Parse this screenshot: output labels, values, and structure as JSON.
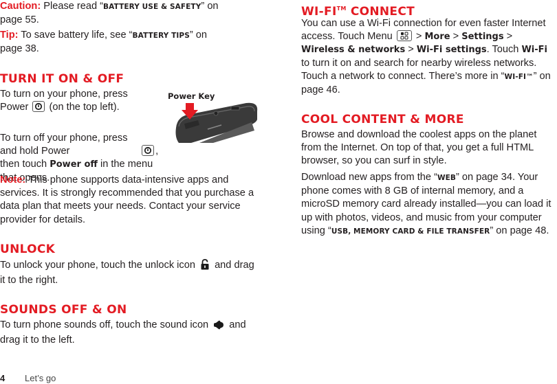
{
  "left": {
    "caution": {
      "label": "Caution:",
      "text_before": " Please read “",
      "ref": "Battery Use & Safety",
      "text_after": "” on page 55."
    },
    "tip": {
      "label": "Tip:",
      "text_before": " To save battery life, see “",
      "ref": "Battery Tips",
      "text_after": "” on page 38."
    },
    "turn_on_off": {
      "heading": "Turn it on & off",
      "p1_a": "To turn on your phone, press Power",
      "p1_b": " (on the top left).",
      "p2_a": "To turn off your phone, press and hold Power",
      "p2_b": ", then touch ",
      "p2_bold": "Power off",
      "p2_c": " in the menu that opens.",
      "figure_label": "Power Key",
      "power_icon": "power-key-icon"
    },
    "note": {
      "label": "Note:",
      "text": " This phone supports data-intensive apps and services. It is strongly recommended that you purchase a data plan that meets your needs. Contact your service provider for details."
    },
    "unlock": {
      "heading": "Unlock",
      "text_a": "To unlock your phone, touch the unlock icon",
      "text_b": " and drag it to the right.",
      "icon": "lock-icon"
    },
    "sounds": {
      "heading": "Sounds off & on",
      "text_a": "To turn phone sounds off, touch the sound icon",
      "text_b": " and drag it to the left.",
      "icon": "speaker-icon"
    }
  },
  "right": {
    "wifi": {
      "heading": "Wi-Fi",
      "heading_tm": "TM",
      "heading_rest": " Connect",
      "t1": "You can use a Wi-Fi connection for even faster Internet access. Touch Menu",
      "t2": " > ",
      "more": "More",
      "t3": " > ",
      "settings": "Settings",
      "t4": " > ",
      "wireless": "Wireless & networks",
      "t5": " > ",
      "wifi_settings": "Wi-Fi settings",
      "t6": ". Touch ",
      "wifi_bold": "Wi-Fi",
      "t7": " to turn it on and search for nearby wireless networks. Touch a network to connect. There’s more in “",
      "ref": "Wi-Fi™",
      "t8": "” on page 46.",
      "menu_icon": "menu-key-icon"
    },
    "cool": {
      "heading": "Cool content & more",
      "p1": "Browse and download the coolest apps on the planet from the Internet. On top of that, you get a full HTML browser, so you can surf in style.",
      "p2_a": "Download new apps from the “",
      "p2_ref": "Web",
      "p2_b": "” on page 34. Your phone comes with 8 GB of internal memory, and a microSD memory card already installed—you can load it up with photos, videos, and music from your computer using “",
      "p2_ref2": "USB, Memory Card & File Transfer",
      "p2_c": "” on page 48."
    }
  },
  "footer": {
    "page_number": "4",
    "section": "Let’s go"
  },
  "colors": {
    "accent": "#e31b23",
    "text": "#231f20"
  }
}
